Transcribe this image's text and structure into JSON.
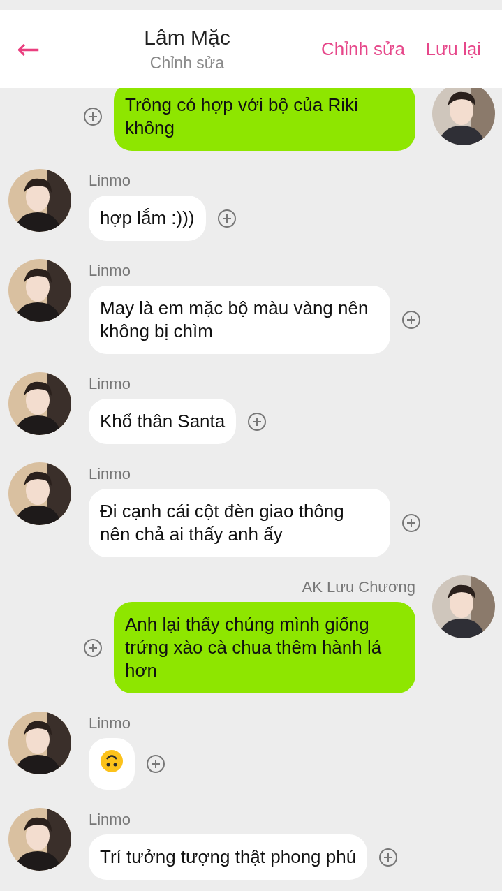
{
  "header": {
    "back": "←",
    "title": "Lâm Mặc",
    "subtitle": "Chỉnh sửa",
    "actions": [
      "Chỉnh sửa",
      "Lưu lại"
    ]
  },
  "messages": [
    {
      "kind": "text",
      "outgoing": true,
      "text": "Trông có hợp với bộ của Riki không"
    },
    {
      "kind": "text",
      "outgoing": false,
      "sender": "Linmo",
      "text": "hợp lắm :)))"
    },
    {
      "kind": "text",
      "outgoing": false,
      "sender": "Linmo",
      "text": "May là em mặc bộ màu vàng nên không bị chìm"
    },
    {
      "kind": "text",
      "outgoing": false,
      "sender": "Linmo",
      "text": "Khổ thân Santa"
    },
    {
      "kind": "text",
      "outgoing": false,
      "sender": "Linmo",
      "text": "Đi cạnh cái cột đèn giao thông nên chả ai thấy anh ấy"
    },
    {
      "kind": "text",
      "outgoing": true,
      "sender": "AK Lưu Chương",
      "text": "Anh lại thấy chúng mình giống trứng xào cà chua thêm hành lá hơn"
    },
    {
      "kind": "emoji",
      "outgoing": false,
      "sender": "Linmo"
    },
    {
      "kind": "text",
      "outgoing": false,
      "sender": "Linmo",
      "text": "Trí tưởng tượng thật phong phú"
    }
  ]
}
